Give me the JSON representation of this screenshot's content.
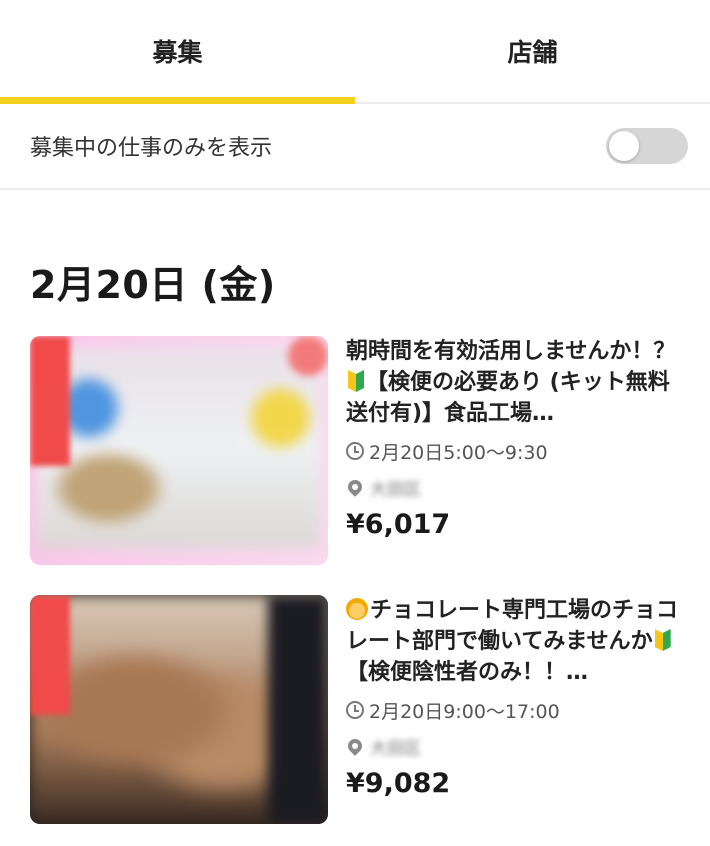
{
  "tabs": [
    {
      "label": "募集",
      "active": true
    },
    {
      "label": "店舗",
      "active": false
    }
  ],
  "filter": {
    "label": "募集中の仕事のみを表示",
    "toggle_on": false
  },
  "date_heading": "2月20日 (金)",
  "jobs": [
    {
      "title_part1": "朝時間を有効活用しませんか！？",
      "title_part2": "【検便の必要あり (キット無料送付有)】食品工場…",
      "time": "2月20日5:00～9:30",
      "area": "大田区",
      "price": "¥6,017"
    },
    {
      "title_part1": "チョコレート専門工場のチョコレート部門で働いてみませんか",
      "title_part2": "【検便陰性者のみ！！…",
      "time": "2月20日9:00～17:00",
      "area": "大田区",
      "price": "¥9,082"
    }
  ],
  "colors": {
    "accent": "#f2d21c",
    "toggle_off": "#d6d6d6"
  }
}
